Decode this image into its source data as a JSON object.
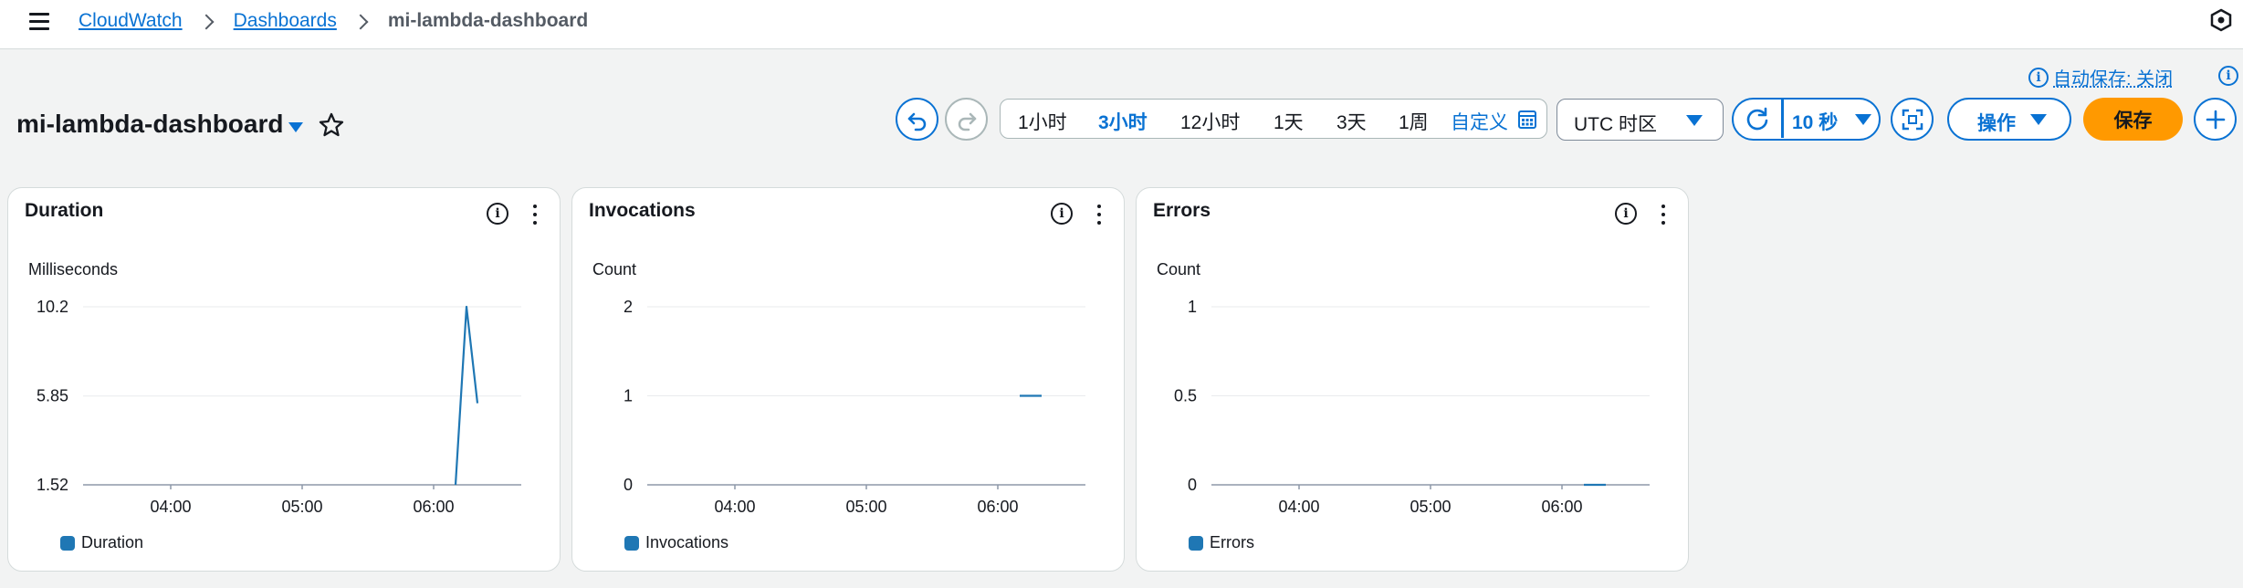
{
  "breadcrumb": {
    "items": [
      "CloudWatch",
      "Dashboards"
    ],
    "current": "mi-lambda-dashboard"
  },
  "autosave": {
    "label": "自动保存: 关闭"
  },
  "dashboard": {
    "title": "mi-lambda-dashboard"
  },
  "time_range": {
    "options": [
      "1小时",
      "3小时",
      "12小时",
      "1天",
      "3天",
      "1周"
    ],
    "selected": "3小时",
    "custom_label": "自定义"
  },
  "timezone": {
    "label": "UTC 时区"
  },
  "refresh": {
    "interval": "10 秒"
  },
  "actions": {
    "label": "操作"
  },
  "save": {
    "label": "保存"
  },
  "colors": {
    "accent": "#0972d3",
    "primary_button": "#ff9900",
    "series": "#1f77b4"
  },
  "widgets": [
    {
      "title": "Duration",
      "unit": "Milliseconds",
      "legend": "Duration",
      "chart_data": {
        "type": "line",
        "ylabel": "Milliseconds",
        "xticks": [
          "04:00",
          "05:00",
          "06:00"
        ],
        "yticks": [
          "10.2",
          "5.85",
          "1.52"
        ],
        "ylim": [
          1.52,
          10.2
        ],
        "series": [
          {
            "name": "Duration",
            "x": [
              "06:10",
              "06:15",
              "06:20"
            ],
            "y": [
              1.52,
              10.2,
              5.5
            ]
          }
        ]
      }
    },
    {
      "title": "Invocations",
      "unit": "Count",
      "legend": "Invocations",
      "chart_data": {
        "type": "line",
        "ylabel": "Count",
        "xticks": [
          "04:00",
          "05:00",
          "06:00"
        ],
        "yticks": [
          "2",
          "1",
          "0"
        ],
        "ylim": [
          0,
          2
        ],
        "series": [
          {
            "name": "Invocations",
            "x": [
              "06:10",
              "06:20"
            ],
            "y": [
              1,
              1
            ]
          }
        ]
      }
    },
    {
      "title": "Errors",
      "unit": "Count",
      "legend": "Errors",
      "chart_data": {
        "type": "line",
        "ylabel": "Count",
        "xticks": [
          "04:00",
          "05:00",
          "06:00"
        ],
        "yticks": [
          "1",
          "0.5",
          "0"
        ],
        "ylim": [
          0,
          1
        ],
        "series": [
          {
            "name": "Errors",
            "x": [
              "06:10",
              "06:20"
            ],
            "y": [
              0,
              0
            ]
          }
        ]
      }
    }
  ]
}
